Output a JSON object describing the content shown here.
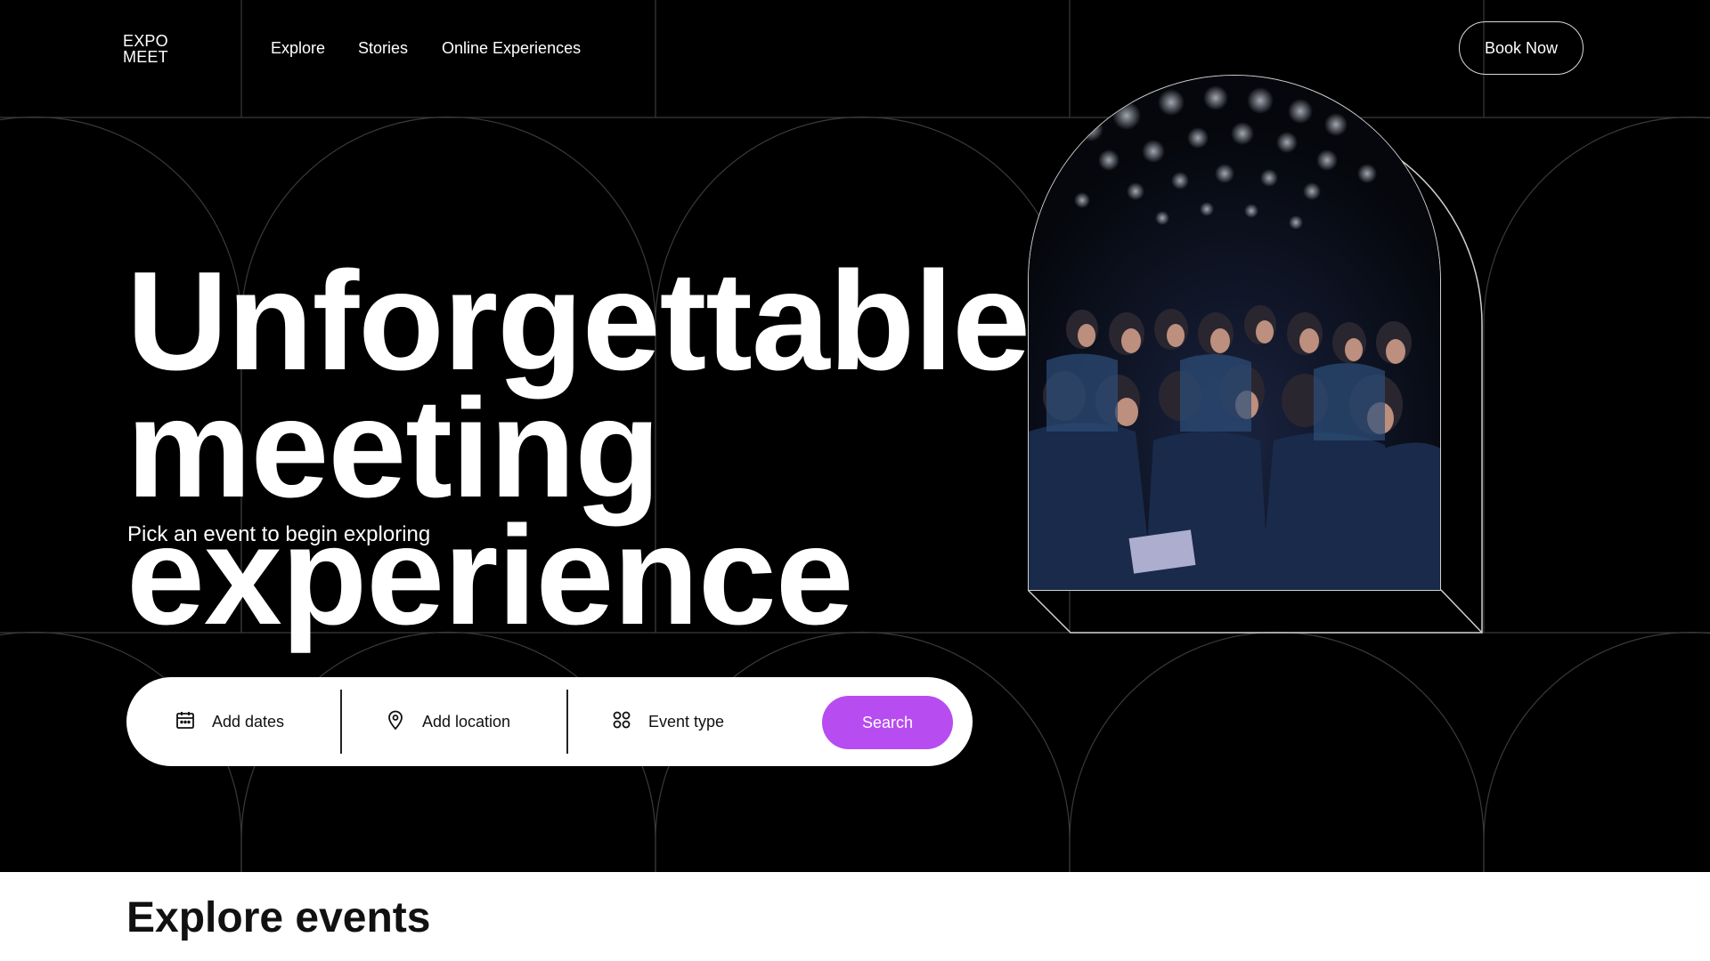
{
  "brand": {
    "line1": "EXPO",
    "line2": "MEET"
  },
  "nav": {
    "links": [
      "Explore",
      "Stories",
      "Online Experiences"
    ],
    "cta": "Book Now"
  },
  "hero": {
    "headline_line1": "Unforgettable",
    "headline_line2": "meeting experience",
    "subtitle": "Pick an event to begin exploring",
    "image_alt": "conference audience photo"
  },
  "search": {
    "dates_label": "Add dates",
    "location_label": "Add location",
    "type_label": "Event type",
    "button_label": "Search"
  },
  "section": {
    "title": "Explore events"
  },
  "colors": {
    "accent": "#b74cf0",
    "background": "#000000",
    "line": "#3a3a3a"
  }
}
